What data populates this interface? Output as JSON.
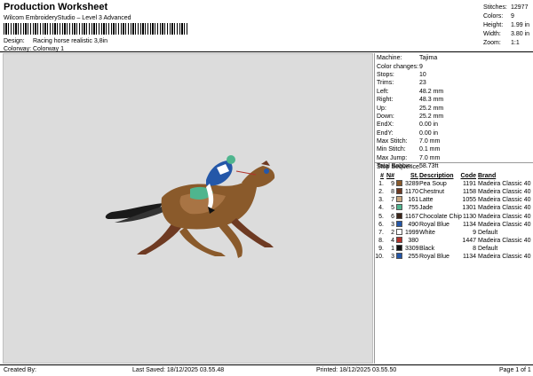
{
  "header": {
    "title": "Production Worksheet",
    "subtitle": "Wilcom EmbroideryStudio – Level 3 Advanced",
    "design_label": "Design:",
    "design_value": "Racing horse realistic 3,8in",
    "colorway_label": "Colorway:",
    "colorway_value": "Colorway 1"
  },
  "stats": [
    {
      "label": "Stitches:",
      "value": "12977"
    },
    {
      "label": "Colors:",
      "value": "9"
    },
    {
      "label": "Height:",
      "value": "1.99 in"
    },
    {
      "label": "Width:",
      "value": "3.80 in"
    },
    {
      "label": "Zoom:",
      "value": "1:1"
    }
  ],
  "machine_info": [
    {
      "label": "Machine:",
      "value": "Tajima"
    },
    {
      "label": "Color changes:",
      "value": "9"
    },
    {
      "label": "Stops:",
      "value": "10"
    },
    {
      "label": "Trims:",
      "value": "23"
    },
    {
      "label": "Left:",
      "value": "48.2 mm"
    },
    {
      "label": "Right:",
      "value": "48.3 mm"
    },
    {
      "label": "Up:",
      "value": "25.2 mm"
    },
    {
      "label": "Down:",
      "value": "25.2 mm"
    },
    {
      "label": "EndX:",
      "value": "0.00 in"
    },
    {
      "label": "EndY:",
      "value": "0.00 in"
    },
    {
      "label": "Max Stitch:",
      "value": "7.0 mm"
    },
    {
      "label": "Min Stitch:",
      "value": "0.1 mm"
    },
    {
      "label": "Max Jump:",
      "value": "7.0 mm"
    },
    {
      "label": "Total Bobbin:",
      "value": "58.73ft"
    }
  ],
  "stop_sequence": {
    "title": "Stop Sequence:",
    "headers": {
      "no": "#",
      "n": "N#",
      "st": "St.",
      "desc": "Description",
      "code": "Code",
      "brand": "Brand"
    },
    "rows": [
      {
        "no": "1.",
        "n": "9",
        "color": "#8a5a2b",
        "st": "3289",
        "desc": "Pea Soup",
        "code": "1191",
        "brand": "Madeira Classic 40"
      },
      {
        "no": "2.",
        "n": "8",
        "color": "#6e3a22",
        "st": "1170",
        "desc": "Chestnut",
        "code": "1158",
        "brand": "Madeira Classic 40"
      },
      {
        "no": "3.",
        "n": "7",
        "color": "#c9a67e",
        "st": "161",
        "desc": "Latte",
        "code": "1055",
        "brand": "Madeira Classic 40"
      },
      {
        "no": "4.",
        "n": "5",
        "color": "#4fb58e",
        "st": "755",
        "desc": "Jade",
        "code": "1301",
        "brand": "Madeira Classic 40"
      },
      {
        "no": "5.",
        "n": "6",
        "color": "#3b2418",
        "st": "1167",
        "desc": "Chocolate Chip",
        "code": "1130",
        "brand": "Madeira Classic 40"
      },
      {
        "no": "6.",
        "n": "3",
        "color": "#2457a8",
        "st": "490",
        "desc": "Royal Blue",
        "code": "1134",
        "brand": "Madeira Classic 40"
      },
      {
        "no": "7.",
        "n": "2",
        "color": "#ffffff",
        "st": "1999",
        "desc": "White",
        "code": "9",
        "brand": "Default"
      },
      {
        "no": "8.",
        "n": "4",
        "color": "#b2322a",
        "st": "380",
        "desc": "",
        "code": "1447",
        "brand": "Madeira Classic 40"
      },
      {
        "no": "9.",
        "n": "1",
        "color": "#111111",
        "st": "3309",
        "desc": "Black",
        "code": "8",
        "brand": "Default"
      },
      {
        "no": "10.",
        "n": "3",
        "color": "#2457a8",
        "st": "255",
        "desc": "Royal Blue",
        "code": "1134",
        "brand": "Madeira Classic 40"
      }
    ]
  },
  "footer": {
    "created_by": "Created By:",
    "last_saved": "Last Saved: 18/12/2025 03.55.48",
    "printed": "Printed: 18/12/2025 03.55.50",
    "page": "Page 1 of 1"
  },
  "colors": {
    "canvas": "#dcdcdc"
  }
}
